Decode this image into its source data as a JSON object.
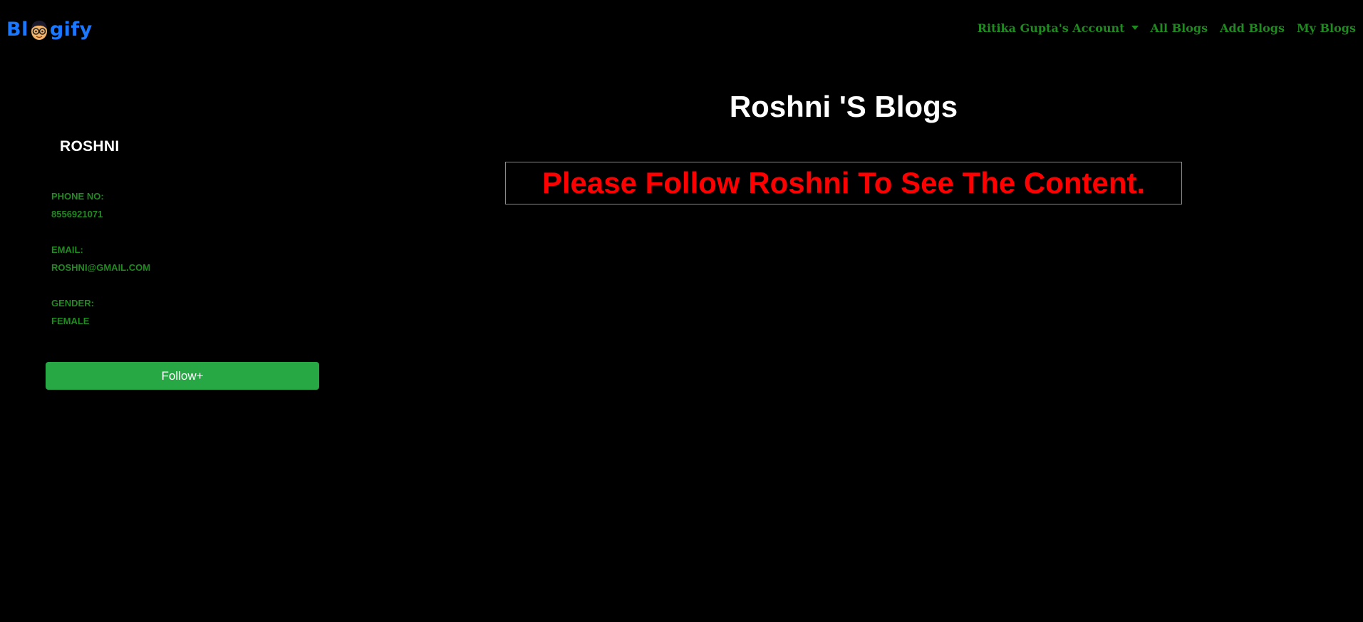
{
  "navbar": {
    "brand_prefix": "Bl",
    "brand_suffix": "gify",
    "brand_color": "#1a78ff",
    "brand_icon": "cartoon-face-logo-icon",
    "account_menu_label": "Ritika Gupta's Account",
    "links": [
      "All Blogs",
      "Add Blogs",
      "My Blogs"
    ],
    "link_color": "#1f8a1f"
  },
  "profile": {
    "name": "ROSHNI",
    "phone_label": "PHONE NO:",
    "phone_value": "8556921071",
    "email_label": "EMAIL:",
    "email_value": "ROSHNI@GMAIL.COM",
    "gender_label": "GENDER:",
    "gender_value": "FEMALE",
    "follow_button_label": "Follow+",
    "follow_button_color": "#28a745"
  },
  "main": {
    "title": "Roshni 'S Blogs",
    "notice": "Please Follow Roshni To See The Content.",
    "notice_color": "#ff0000"
  }
}
